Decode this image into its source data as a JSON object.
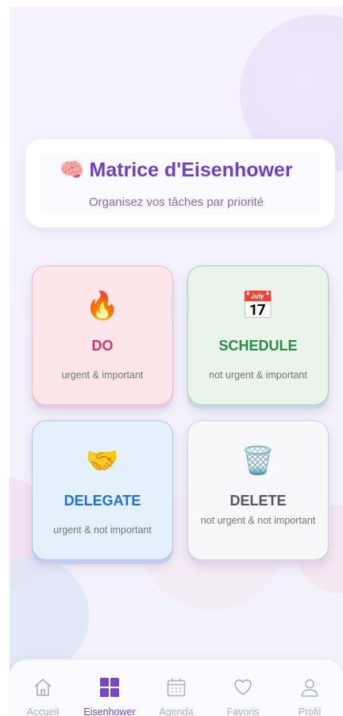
{
  "header": {
    "emoji": "🧠",
    "title": "Matrice d'Eisenhower",
    "subtitle": "Organisez vos tâches par priorité"
  },
  "quadrants": [
    {
      "key": "do",
      "icon": "🔥",
      "label": "DO",
      "description": "urgent & important",
      "color": "#d6316f"
    },
    {
      "key": "schedule",
      "icon": "📅",
      "label": "SCHEDULE",
      "description": "not urgent & important",
      "color": "#2d8a4b"
    },
    {
      "key": "delegate",
      "icon": "🤝",
      "label": "DELEGATE",
      "description": "urgent & not important",
      "color": "#1f6fd6"
    },
    {
      "key": "delete",
      "icon": "🗑️",
      "label": "DELETE",
      "description": "not urgent & not important",
      "color": "#535762"
    }
  ],
  "tabbar": {
    "active": "Eisenhower",
    "active_color": "#7645c8",
    "inactive_color": "#a5b3c4",
    "items": [
      {
        "label": "Accueil",
        "icon": "home-icon"
      },
      {
        "label": "Eisenhower",
        "icon": "grid-icon"
      },
      {
        "label": "Agenda",
        "icon": "calendar-icon"
      },
      {
        "label": "Favoris",
        "icon": "heart-icon"
      },
      {
        "label": "Profil",
        "icon": "user-icon"
      }
    ]
  }
}
